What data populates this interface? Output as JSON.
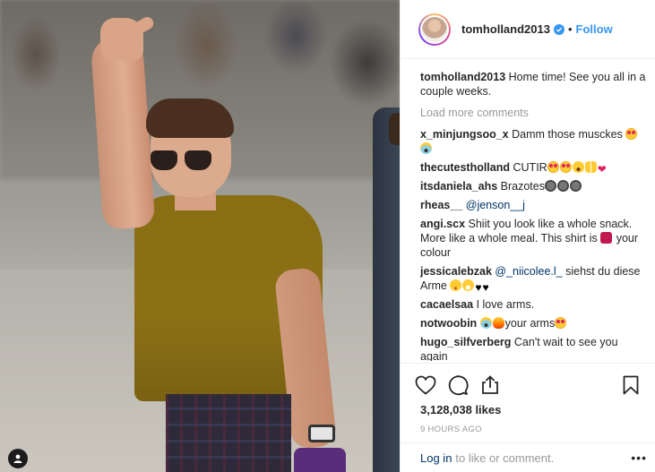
{
  "header": {
    "username": "tomholland2013",
    "separator": "•",
    "follow_label": "Follow"
  },
  "caption": {
    "username": "tomholland2013",
    "text": "Home time! See you all in a couple weeks."
  },
  "load_more_label": "Load more comments",
  "comments": [
    {
      "username": "x_minjungsoo_x",
      "text": "Damm those musckes",
      "emojis": [
        "heart-eyes",
        "scream"
      ]
    },
    {
      "username": "thecutestholland",
      "text": "CUTIR",
      "emojis": [
        "heart-eyes",
        "heart-eyes",
        "wow",
        "raised-hands",
        "red-heart"
      ]
    },
    {
      "username": "itsdaniela_ahs",
      "text": "Brazotes",
      "emojis": [
        "dark-face",
        "dark-face",
        "dark-face"
      ]
    },
    {
      "username": "rheas__",
      "mention": "@jenson__j",
      "text": ""
    },
    {
      "username": "angi.scx",
      "text": "Shiit you look like a whole snack. More like a whole meal. This shirt is",
      "text_after": "your colour",
      "emojis": [
        "sparkle-heart"
      ]
    },
    {
      "username": "jessicalebzak",
      "mention": "@_niicolee.l_",
      "text": "siehst du diese Arme",
      "emojis": [
        "relieved",
        "grin",
        "black-heart",
        "black-heart"
      ]
    },
    {
      "username": "cacaelsaa",
      "text": "I love arms."
    },
    {
      "username": "notwoobin",
      "text": "your arms",
      "emojis": [
        "scream",
        "fire",
        "heart-eyes"
      ]
    },
    {
      "username": "hugo_silfverberg",
      "text": "Can't wait to see you again"
    }
  ],
  "likes_text": "3,128,038 likes",
  "timestamp": "9 HOURS AGO",
  "footer": {
    "login_label": "Log in",
    "rest_text": "to like or comment.",
    "more_label": "•••"
  },
  "icons": [
    "heart-icon",
    "comment-icon",
    "share-icon",
    "bookmark-icon",
    "tag-user-icon",
    "verified-icon"
  ],
  "colors": {
    "accent": "#3897f0",
    "text": "#262626",
    "muted": "#999999",
    "link": "#003569"
  }
}
